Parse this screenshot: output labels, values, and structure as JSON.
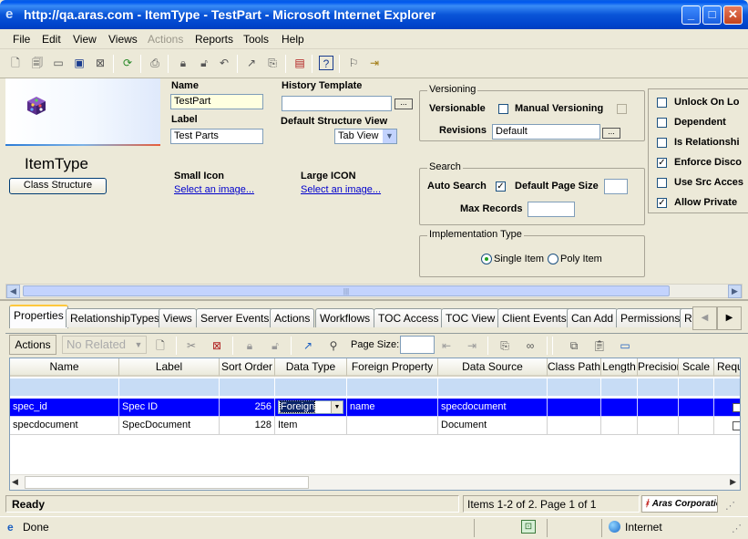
{
  "window": {
    "title": "http://qa.aras.com - ItemType - TestPart - Microsoft Internet Explorer",
    "minimize": "_",
    "maximize": "□",
    "close": "✕"
  },
  "menu": [
    {
      "label": "File",
      "enabled": true
    },
    {
      "label": "Edit",
      "enabled": true
    },
    {
      "label": "View",
      "enabled": true
    },
    {
      "label": "Views",
      "enabled": true
    },
    {
      "label": "Actions",
      "enabled": false
    },
    {
      "label": "Reports",
      "enabled": true
    },
    {
      "label": "Tools",
      "enabled": true
    },
    {
      "label": "Help",
      "enabled": true
    }
  ],
  "toolbar_icons": [
    "new-icon",
    "print-preview-icon",
    "open-icon",
    "save-icon",
    "close-doc-icon",
    "refresh-icon",
    "print-icon",
    "lock-icon",
    "unlock-icon",
    "undo-icon",
    "promote-icon",
    "revisions-icon",
    "report-icon",
    "help-icon",
    "properties-icon",
    "exit-icon"
  ],
  "form": {
    "item_type_title": "ItemType",
    "class_structure_button": "Class Structure",
    "name_label": "Name",
    "name_value": "TestPart",
    "label_label": "Label",
    "label_value": "Test Parts",
    "history_template_label": "History Template",
    "history_template_value": "",
    "default_structure_view_label": "Default Structure View",
    "default_structure_view_value": "Tab View",
    "small_icon_label": "Small Icon",
    "small_icon_link": "Select an image...",
    "large_icon_label": "Large ICON",
    "large_icon_link": "Select an image...",
    "ellipsis": "...",
    "versioning": {
      "legend": "Versioning",
      "versionable_label": "Versionable",
      "versionable": false,
      "manual_versioning_label": "Manual Versioning",
      "manual_versioning": false,
      "revisions_label": "Revisions",
      "revisions_value": "Default"
    },
    "search": {
      "legend": "Search",
      "auto_search_label": "Auto Search",
      "auto_search": true,
      "default_page_size_label": "Default Page Size",
      "default_page_size_value": "",
      "max_records_label": "Max Records",
      "max_records_value": ""
    },
    "implementation": {
      "legend": "Implementation Type",
      "single_item_label": "Single Item",
      "poly_item_label": "Poly Item",
      "selected": "single"
    },
    "flags": [
      {
        "label": "Unlock On Lo",
        "checked": false
      },
      {
        "label": "Dependent",
        "checked": false
      },
      {
        "label": "Is Relationshi",
        "checked": false
      },
      {
        "label": "Enforce Disco",
        "checked": true
      },
      {
        "label": "Use Src Acces",
        "checked": false
      },
      {
        "label": "Allow Private",
        "checked": true
      }
    ]
  },
  "tabs": [
    "Properties",
    "RelationshipTypes",
    "Views",
    "Server Events",
    "Actions",
    "Workflows",
    "TOC Access",
    "TOC View",
    "Client Events",
    "Can Add",
    "Permissions",
    "R"
  ],
  "active_tab": "Properties",
  "grid_toolbar": {
    "actions_label": "Actions",
    "related_select": "No Related",
    "page_size_label": "Page Size:",
    "page_size_value": ""
  },
  "grid": {
    "columns": [
      "Name",
      "Label",
      "Sort Order",
      "Data Type",
      "Foreign Property",
      "Data Source",
      "Class Path",
      "Length",
      "Precision",
      "Scale",
      "Requ"
    ],
    "rows": [
      {
        "name": "spec_id",
        "label": "Spec ID",
        "sort_order": "256",
        "data_type": "Foreign",
        "foreign_property": "name",
        "data_source": "specdocument",
        "selected": true
      },
      {
        "name": "specdocument",
        "label": "SpecDocument",
        "sort_order": "128",
        "data_type": "Item",
        "foreign_property": "",
        "data_source": "Document",
        "selected": false
      }
    ]
  },
  "status": {
    "left": "Ready",
    "items": "Items 1-2 of 2. Page 1 of 1",
    "brand": "Aras Corporatio"
  },
  "ie_status": {
    "left": "Done",
    "zone": "Internet"
  }
}
